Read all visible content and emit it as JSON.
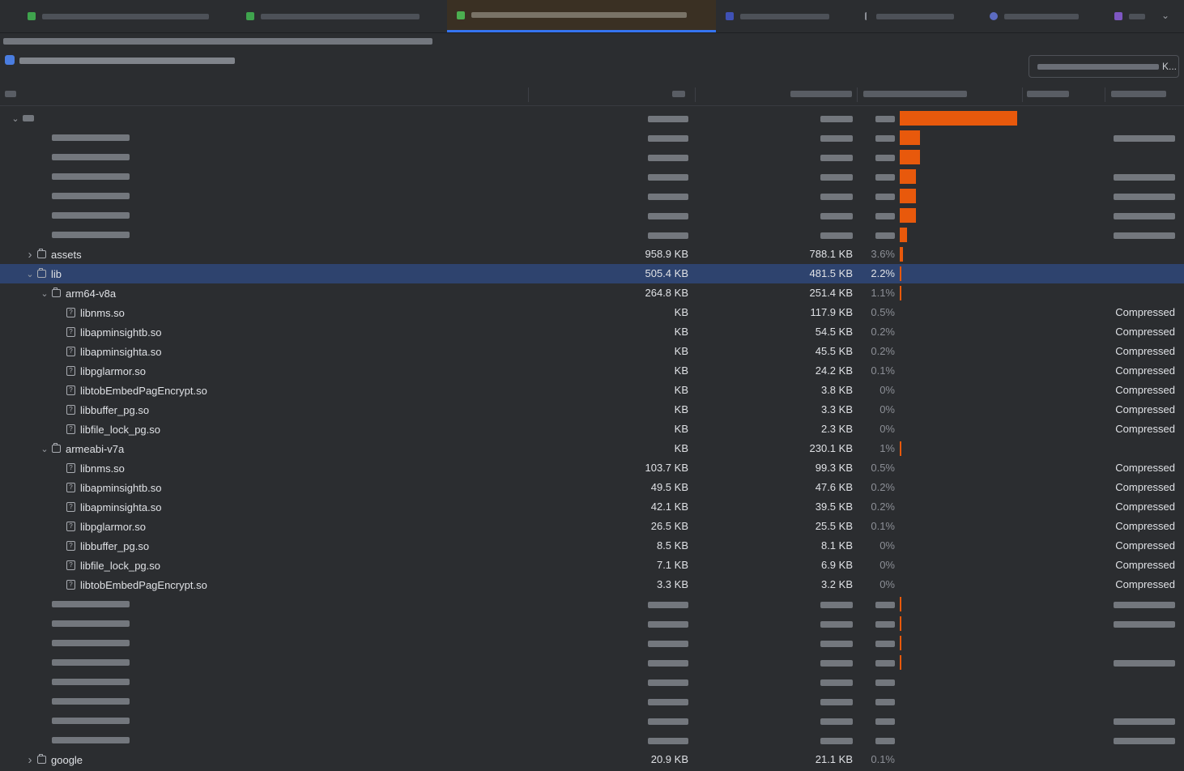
{
  "tabs": [
    {
      "icon_color": "#3fa34d",
      "active": false
    },
    {
      "icon_color": "#3fa34d",
      "active": false
    },
    {
      "icon_color": "#4caf50",
      "active": true
    },
    {
      "icon_color": "#3f51b5",
      "active": false
    },
    {
      "icon_color": "#8c8f96",
      "active": false
    },
    {
      "icon_color": "#5c6bc0",
      "active": false
    },
    {
      "icon_color": "#7e57c2",
      "active": false
    }
  ],
  "header": {
    "compare_suffix": "K..."
  },
  "accent": {
    "bar_color": "#e8590c",
    "selection_color": "#2e436e",
    "tab_underline": "#3574f0"
  },
  "rows": [
    {
      "depth": 0,
      "kind": "blur",
      "expanded": true,
      "raw": "",
      "dl": "",
      "pct": "",
      "bar": 1.0,
      "comp": ""
    },
    {
      "depth": 1,
      "kind": "blur",
      "raw": "",
      "dl": "",
      "pct": "",
      "bar": 0.17,
      "comp": "blur"
    },
    {
      "depth": 1,
      "kind": "blur",
      "raw": "",
      "dl": "",
      "pct": "",
      "bar": 0.17,
      "comp": ""
    },
    {
      "depth": 1,
      "kind": "blur",
      "raw": "",
      "dl": "",
      "pct": "",
      "bar": 0.14,
      "comp": "blur"
    },
    {
      "depth": 1,
      "kind": "blur",
      "raw": "",
      "dl": "",
      "pct": "",
      "bar": 0.14,
      "comp": "blur"
    },
    {
      "depth": 1,
      "kind": "blur",
      "raw": "",
      "dl": "",
      "pct": "",
      "bar": 0.14,
      "comp": "blur"
    },
    {
      "depth": 1,
      "kind": "blur",
      "raw": "",
      "dl": "",
      "pct": "",
      "bar": 0.06,
      "comp": "blur"
    },
    {
      "depth": 1,
      "kind": "folder",
      "arrow": "right",
      "name": "assets",
      "raw": "958.9 KB",
      "dl": "788.1 KB",
      "pct": "3.6%",
      "bar": 0.025,
      "comp": ""
    },
    {
      "depth": 1,
      "kind": "folder",
      "arrow": "down",
      "name": "lib",
      "raw": "505.4 KB",
      "dl": "481.5 KB",
      "pct": "2.2%",
      "bar": 0.015,
      "comp": "",
      "selected": true
    },
    {
      "depth": 2,
      "kind": "folder",
      "arrow": "down",
      "name": "arm64-v8a",
      "raw": "264.8 KB",
      "dl": "251.4 KB",
      "pct": "1.1%",
      "bar": 0.008,
      "comp": ""
    },
    {
      "depth": 3,
      "kind": "file",
      "name": "libnms.so",
      "raw": "KB",
      "dl": "117.9 KB",
      "pct": "0.5%",
      "bar": 0,
      "comp": "Compressed"
    },
    {
      "depth": 3,
      "kind": "file",
      "name": "libapminsightb.so",
      "raw": "KB",
      "dl": "54.5 KB",
      "pct": "0.2%",
      "bar": 0,
      "comp": "Compressed"
    },
    {
      "depth": 3,
      "kind": "file",
      "name": "libapminsighta.so",
      "raw": "KB",
      "dl": "45.5 KB",
      "pct": "0.2%",
      "bar": 0,
      "comp": "Compressed"
    },
    {
      "depth": 3,
      "kind": "file",
      "name": "libpglarmor.so",
      "raw": "KB",
      "dl": "24.2 KB",
      "pct": "0.1%",
      "bar": 0,
      "comp": "Compressed"
    },
    {
      "depth": 3,
      "kind": "file",
      "name": "libtobEmbedPagEncrypt.so",
      "raw": "KB",
      "dl": "3.8 KB",
      "pct": "0%",
      "bar": 0,
      "comp": "Compressed"
    },
    {
      "depth": 3,
      "kind": "file",
      "name": "libbuffer_pg.so",
      "raw": "KB",
      "dl": "3.3 KB",
      "pct": "0%",
      "bar": 0,
      "comp": "Compressed"
    },
    {
      "depth": 3,
      "kind": "file",
      "name": "libfile_lock_pg.so",
      "raw": "KB",
      "dl": "2.3 KB",
      "pct": "0%",
      "bar": 0,
      "comp": "Compressed"
    },
    {
      "depth": 2,
      "kind": "folder",
      "arrow": "down",
      "name": "armeabi-v7a",
      "raw": "KB",
      "dl": "230.1 KB",
      "pct": "1%",
      "bar": 0.008,
      "comp": ""
    },
    {
      "depth": 3,
      "kind": "file",
      "name": "libnms.so",
      "raw": "103.7 KB",
      "dl": "99.3 KB",
      "pct": "0.5%",
      "bar": 0,
      "comp": "Compressed"
    },
    {
      "depth": 3,
      "kind": "file",
      "name": "libapminsightb.so",
      "raw": "49.5 KB",
      "dl": "47.6 KB",
      "pct": "0.2%",
      "bar": 0,
      "comp": "Compressed"
    },
    {
      "depth": 3,
      "kind": "file",
      "name": "libapminsighta.so",
      "raw": "42.1 KB",
      "dl": "39.5 KB",
      "pct": "0.2%",
      "bar": 0,
      "comp": "Compressed"
    },
    {
      "depth": 3,
      "kind": "file",
      "name": "libpglarmor.so",
      "raw": "26.5 KB",
      "dl": "25.5 KB",
      "pct": "0.1%",
      "bar": 0,
      "comp": "Compressed"
    },
    {
      "depth": 3,
      "kind": "file",
      "name": "libbuffer_pg.so",
      "raw": "8.5 KB",
      "dl": "8.1 KB",
      "pct": "0%",
      "bar": 0,
      "comp": "Compressed"
    },
    {
      "depth": 3,
      "kind": "file",
      "name": "libfile_lock_pg.so",
      "raw": "7.1 KB",
      "dl": "6.9 KB",
      "pct": "0%",
      "bar": 0,
      "comp": "Compressed"
    },
    {
      "depth": 3,
      "kind": "file",
      "name": "libtobEmbedPagEncrypt.so",
      "raw": "3.3 KB",
      "dl": "3.2 KB",
      "pct": "0%",
      "bar": 0,
      "comp": "Compressed"
    },
    {
      "depth": 1,
      "kind": "blur",
      "raw": "",
      "dl": "",
      "pct": "",
      "bar": 0.008,
      "comp": "blur"
    },
    {
      "depth": 1,
      "kind": "blur",
      "raw": "",
      "dl": "",
      "pct": "",
      "bar": 0.006,
      "comp": "blur"
    },
    {
      "depth": 1,
      "kind": "blur",
      "raw": "",
      "dl": "",
      "pct": "",
      "bar": 0.006,
      "comp": ""
    },
    {
      "depth": 1,
      "kind": "blur",
      "raw": "",
      "dl": "",
      "pct": "",
      "bar": 0.006,
      "comp": "blur"
    },
    {
      "depth": 1,
      "kind": "blur",
      "raw": "",
      "dl": "",
      "pct": "",
      "bar": 0,
      "comp": ""
    },
    {
      "depth": 1,
      "kind": "blur",
      "raw": "",
      "dl": "",
      "pct": "",
      "bar": 0,
      "comp": ""
    },
    {
      "depth": 1,
      "kind": "blur",
      "raw": "",
      "dl": "",
      "pct": "",
      "bar": 0,
      "comp": "blur"
    },
    {
      "depth": 1,
      "kind": "blur",
      "raw": "",
      "dl": "",
      "pct": "",
      "bar": 0,
      "comp": "blur"
    },
    {
      "depth": 1,
      "kind": "folder",
      "arrow": "right",
      "name": "google",
      "raw": "20.9 KB",
      "dl": "21.1 KB",
      "pct": "0.1%",
      "bar": 0,
      "comp": ""
    }
  ]
}
